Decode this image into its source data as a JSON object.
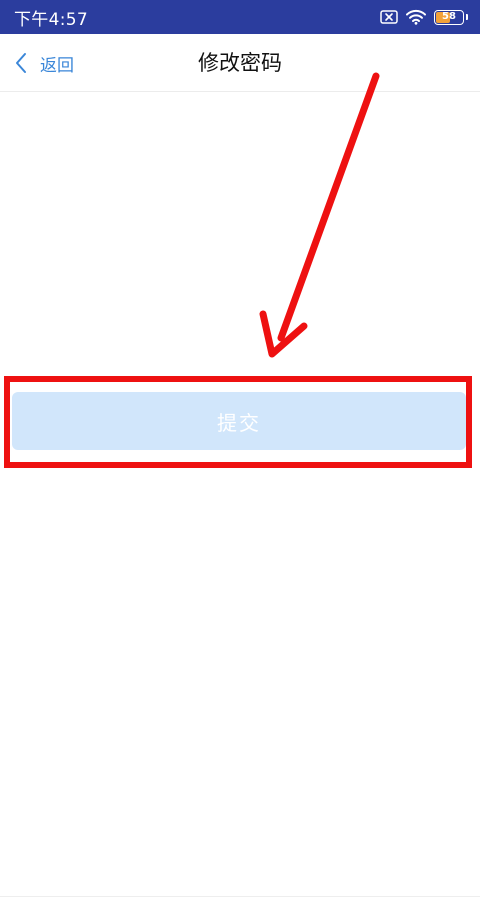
{
  "status_bar": {
    "time": "下午4:57",
    "battery_level": "58",
    "battery_fraction": 0.58,
    "background_color": "#2b3d9e",
    "icons": [
      "sim-x-icon",
      "wifi-icon",
      "battery-icon"
    ]
  },
  "nav": {
    "back_label": "返回",
    "title": "修改密码",
    "back_icon": "chevron-left-icon",
    "accent_color": "#3a86d8"
  },
  "form": {
    "submit_label": "提交",
    "submit_state": "disabled",
    "submit_color": "#d1e6fb"
  },
  "annotation": {
    "highlight_color": "#ee1111",
    "arrow_icon": "red-arrow-icon"
  }
}
